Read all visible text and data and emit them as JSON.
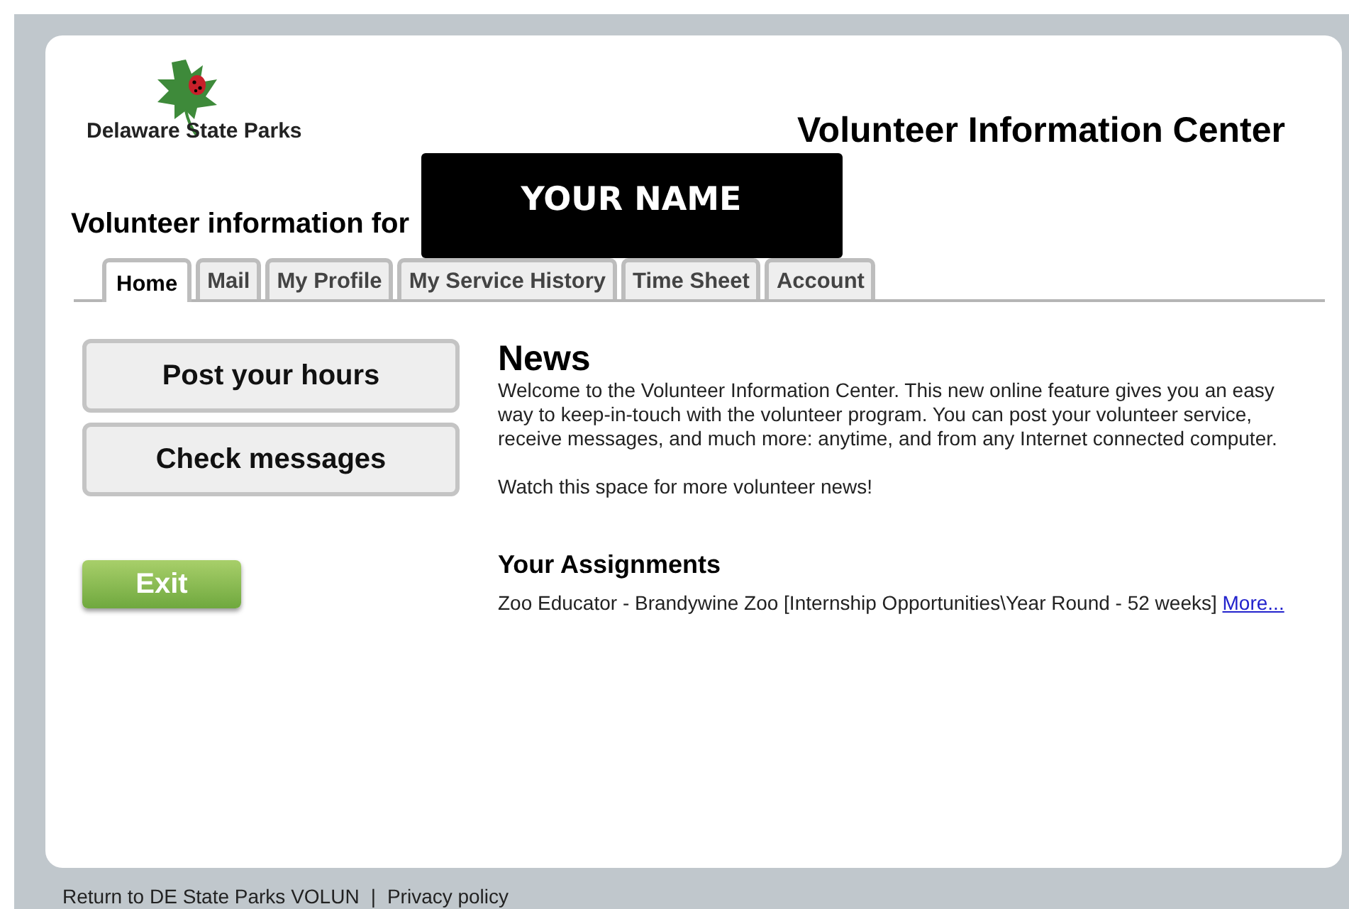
{
  "logo": {
    "text": "Delaware State Parks"
  },
  "header": {
    "title": "Volunteer Information Center"
  },
  "volunteer": {
    "label": "Volunteer information for",
    "name": "YOUR NAME"
  },
  "tabs": [
    {
      "label": "Home",
      "selected": true
    },
    {
      "label": "Mail",
      "selected": false
    },
    {
      "label": "My Profile",
      "selected": false
    },
    {
      "label": "My Service History",
      "selected": false
    },
    {
      "label": "Time Sheet",
      "selected": false
    },
    {
      "label": "Account",
      "selected": false
    }
  ],
  "actions": [
    "Post your hours",
    "Check messages"
  ],
  "news": {
    "heading": "News",
    "paragraphs": [
      "Welcome to the Volunteer Information Center. This new online feature gives you an easy way to keep-in-touch with the volunteer program. You can post your volunteer service, receive messages, and much more: anytime, and from any Internet connected computer.",
      "Watch this space for more volunteer news!"
    ]
  },
  "assignments": {
    "heading": "Your Assignments",
    "text": "Zoo Educator - Brandywine Zoo [Internship Opportunities\\Year Round - 52 weeks]",
    "link": "More..."
  },
  "exit_button": "Exit",
  "footer": {
    "links": [
      "Return to DE State Parks VOLUN",
      "Privacy policy"
    ],
    "separator": "|"
  }
}
